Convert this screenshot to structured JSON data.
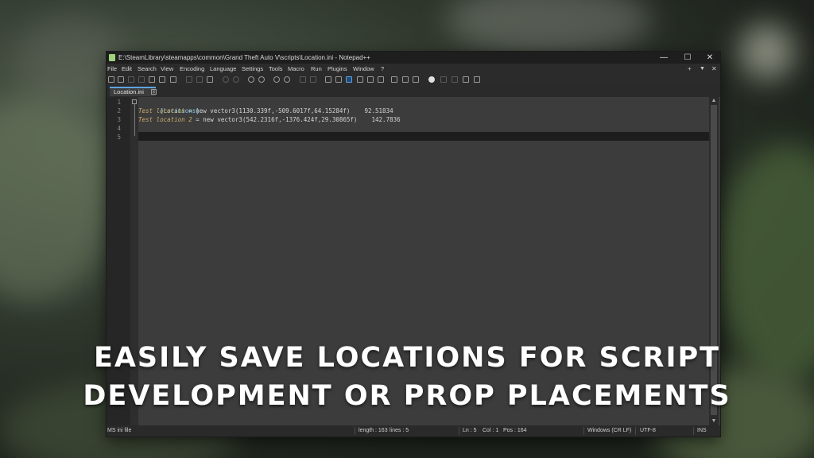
{
  "window": {
    "title": "E:\\SteamLibrary\\steamapps\\common\\Grand Theft Auto V\\scripts\\Location.ini - Notepad++",
    "minimize": "—",
    "maximize": "☐",
    "close": "✕"
  },
  "menu": {
    "items": [
      "File",
      "Edit",
      "Search",
      "View",
      "Encoding",
      "Language",
      "Settings",
      "Tools",
      "Macro",
      "Run",
      "Plugins",
      "Window",
      "?"
    ],
    "right": [
      "+",
      "▼",
      "✕"
    ]
  },
  "tab": {
    "label": "Location.ini",
    "close": "x"
  },
  "editor": {
    "line_numbers": [
      "1",
      "2",
      "3",
      "4",
      "5"
    ],
    "lines": [
      {
        "section": "[Locations]"
      },
      {
        "key": "Test location",
        "rest": " = new vector3(1130.339f,-509.6017f,64.15284f)    92.51834"
      },
      {
        "key": "Test location 2",
        "rest": " = new vector3(542.2316f,-1376.424f,29.30865f)    142.7836"
      },
      {
        "text": ""
      },
      {
        "text": ""
      }
    ]
  },
  "status": {
    "file_type": "MS ini file",
    "length": "length : 163",
    "lines": "lines : 5",
    "ln": "Ln : 5",
    "col": "Col : 1",
    "pos": "Pos : 164",
    "eol": "Windows (CR LF)",
    "encoding": "UTF-8",
    "mode": "INS"
  },
  "caption": {
    "line1": "EASILY SAVE LOCATIONS FOR SCRIPT",
    "line2": "DEVELOPMENT OR PROP PLACEMENTS"
  }
}
